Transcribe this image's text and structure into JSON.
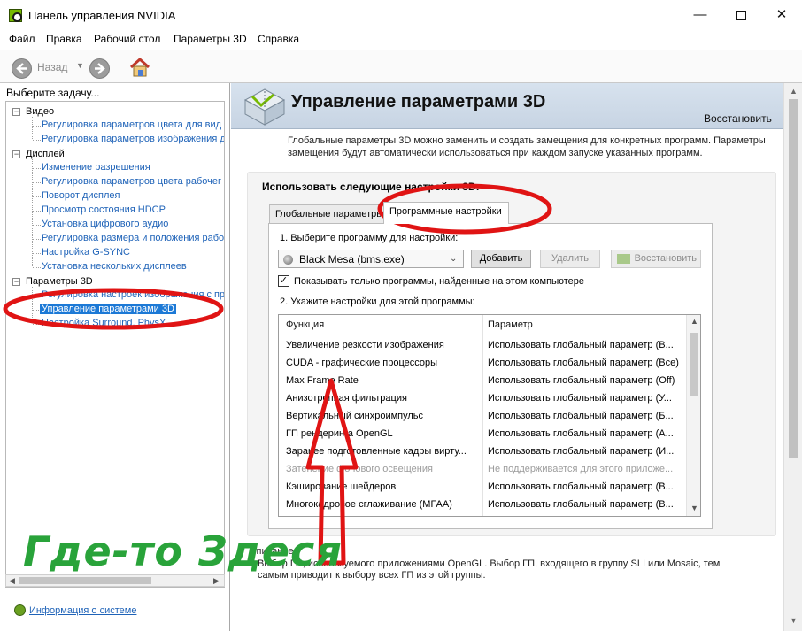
{
  "window": {
    "title": "Панель управления NVIDIA",
    "minimize": "—",
    "close": "✕"
  },
  "menu": [
    "Файл",
    "Правка",
    "Рабочий стол",
    "Параметры 3D",
    "Справка"
  ],
  "toolbar": {
    "back_label": "Назад",
    "back_icon": "arrow-left-icon",
    "forward_icon": "arrow-right-icon",
    "home_icon": "home-icon"
  },
  "left": {
    "title": "Выберите задачу...",
    "groups": [
      {
        "label": "Видео",
        "items": [
          "Регулировка параметров цвета для вид",
          "Регулировка параметров изображения д"
        ]
      },
      {
        "label": "Дисплей",
        "items": [
          "Изменение разрешения",
          "Регулировка параметров цвета рабочег",
          "Поворот дисплея",
          "Просмотр состояния HDCP",
          "Установка цифрового аудио",
          "Регулировка размера и положения рабо",
          "Настройка G-SYNC",
          "Установка нескольких дисплеев"
        ]
      },
      {
        "label": "Параметры 3D",
        "items": [
          "Регулировка настроек изображения с пр",
          "Управление параметрами 3D",
          "Настройка Surround, PhysX"
        ]
      }
    ],
    "selected": "Управление параметрами 3D",
    "sysinfo_link": "Информация о системе"
  },
  "main": {
    "title": "Управление параметрами 3D",
    "restore": "Восстановить",
    "description": "Глобальные параметры 3D можно заменить и создать замещения для конкретных программ. Параметры замещения будут автоматически использоваться при каждом запуске указанных программ.",
    "group_title": "Использовать следующие настройки 3D:",
    "tabs": [
      "Глобальные параметры",
      "Программные настройки"
    ],
    "active_tab": "Программные настройки",
    "step1": "1. Выберите программу для настройки:",
    "program": "Black Mesa (bms.exe)",
    "btn_add": "Добавить",
    "btn_delete": "Удалить",
    "btn_restore": "Восстановить",
    "checkbox_label": "Показывать только программы, найденные на этом компьютере",
    "checkbox_checked": true,
    "step2": "2. Укажите настройки для этой программы:",
    "columns": [
      "Функция",
      "Параметр"
    ],
    "rows": [
      {
        "fn": "Увеличение резкости изображения",
        "val": "Использовать глобальный параметр (В..."
      },
      {
        "fn": "CUDA - графические процессоры",
        "val": "Использовать глобальный параметр (Все)"
      },
      {
        "fn": "Max Frame Rate",
        "val": "Использовать глобальный параметр (Off)"
      },
      {
        "fn": "Анизотропная фильтрация",
        "val": "Использовать глобальный параметр (У..."
      },
      {
        "fn": "Вертикальный синхроимпульс",
        "val": "Использовать глобальный параметр (Б..."
      },
      {
        "fn": "ГП рендеринга OpenGL",
        "val": "Использовать глобальный параметр (А..."
      },
      {
        "fn": "Заранее подготовленные кадры вирту...",
        "val": "Использовать глобальный параметр (И..."
      },
      {
        "fn": "Затенение фонового освещения",
        "val": "Не поддерживается для этого приложе...",
        "dim": true
      },
      {
        "fn": "Кэширование шейдеров",
        "val": "Использовать глобальный параметр (В..."
      },
      {
        "fn": "Многокадровое сглаживание (MFAA)",
        "val": "Использовать глобальный параметр (В..."
      }
    ],
    "desc_label": "Описание:",
    "desc_text": "Выбор ГП, используемого приложениями OpenGL. Выбор ГП, входящего в группу SLI или Mosaic, тем самым приводит к выбору всех ГП из этой группы."
  },
  "annotation": {
    "text": "Где-то Здеся",
    "text_color": "#29a33a",
    "mark_color": "#e01414"
  }
}
